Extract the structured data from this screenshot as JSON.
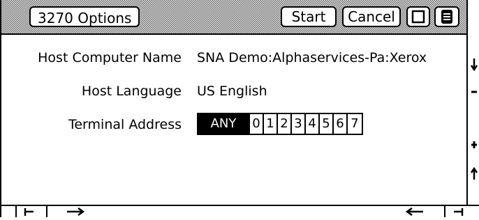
{
  "window": {
    "title": "3270 Options",
    "buttons": {
      "start": "Start",
      "cancel": "Cancel"
    }
  },
  "form": {
    "host_computer_name": {
      "label": "Host Computer Name",
      "value": "SNA Demo:Alphaservices-Pa:Xerox"
    },
    "host_language": {
      "label": "Host Language",
      "value": "US English"
    },
    "terminal_address": {
      "label": "Terminal Address",
      "options": [
        "ANY",
        "0",
        "1",
        "2",
        "3",
        "4",
        "5",
        "6",
        "7"
      ],
      "selected": "ANY"
    }
  },
  "icons": {
    "title_square": "square-icon",
    "title_menu": "menu-icon",
    "scroll": [
      "arrow-down-icon",
      "minus-icon",
      "plus-icon",
      "arrow-up-icon",
      "arrow-left-icon",
      "arrow-right-icon"
    ]
  }
}
